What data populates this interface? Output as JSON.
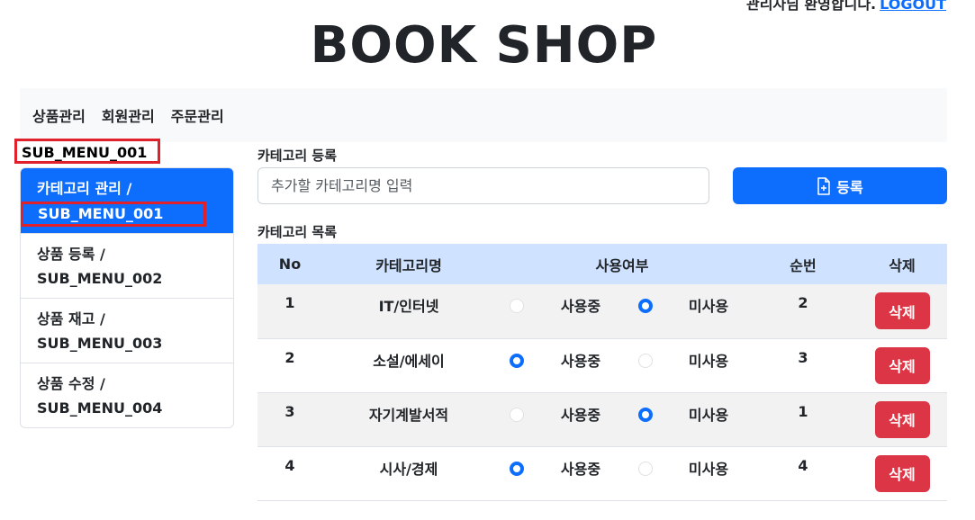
{
  "header": {
    "welcome_text": "관리자님 환영합니다.",
    "logout_label": "LOGOUT",
    "brand": "BOOK SHOP"
  },
  "nav": {
    "items": [
      "상품관리",
      "회원관리",
      "주문관리"
    ]
  },
  "sidebar": {
    "title": "SUB_MENU_001",
    "items": [
      {
        "label": "카테고리 관리 /",
        "code": "SUB_MENU_001",
        "active": true
      },
      {
        "label": "상품 등록 /",
        "code": "SUB_MENU_002",
        "active": false
      },
      {
        "label": "상품 재고 /",
        "code": "SUB_MENU_003",
        "active": false
      },
      {
        "label": "상품 수정 /",
        "code": "SUB_MENU_004",
        "active": false
      }
    ]
  },
  "register": {
    "section_label": "카테고리 등록",
    "input_placeholder": "추가할 카테고리명 입력",
    "button_label": "등록",
    "button_icon": "file-plus-icon"
  },
  "list": {
    "section_label": "카테고리 목록",
    "headers": [
      "No",
      "카테고리명",
      "사용여부",
      "순번",
      "삭제"
    ],
    "use_label": "사용중",
    "unused_label": "미사용",
    "delete_label": "삭제",
    "rows": [
      {
        "no": "1",
        "name": "IT/인터넷",
        "in_use": false,
        "order": "2"
      },
      {
        "no": "2",
        "name": "소설/에세이",
        "in_use": true,
        "order": "3"
      },
      {
        "no": "3",
        "name": "자기계발서적",
        "in_use": false,
        "order": "1"
      },
      {
        "no": "4",
        "name": "시사/경제",
        "in_use": true,
        "order": "4"
      }
    ]
  },
  "colors": {
    "primary": "#0d6efd",
    "danger": "#dc3545",
    "table_header": "#cfe2ff",
    "highlight_box": "#e0202b"
  }
}
